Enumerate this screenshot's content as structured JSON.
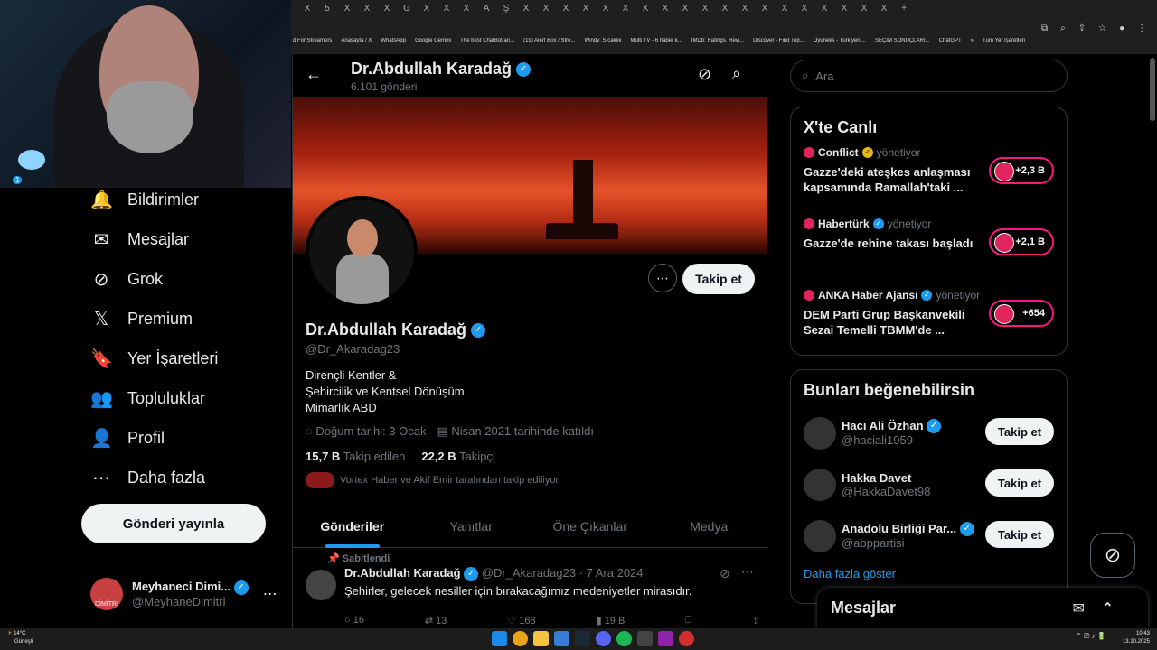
{
  "browser": {
    "tabs": [
      "X",
      "5",
      "X",
      "X",
      "X",
      "G",
      "X",
      "X",
      "X",
      "A",
      "Ş",
      "X",
      "X",
      "X",
      "X",
      "X",
      "X",
      "X",
      "X",
      "X",
      "X",
      "X",
      "X",
      "X",
      "X",
      "X",
      "X",
      "X",
      "X",
      "X",
      "+"
    ],
    "bookmarks": [
      "d For Streamers",
      "Anasayfa / X",
      "WhatsApp",
      "Google Gemini",
      "The best ChatBot an...",
      "(19) Alert Box / Stre...",
      "Windy: Sıcaklık",
      "Multi TV - 6 haber k...",
      "IMDb: Ratings, Revi...",
      "Discover - Find Top...",
      "Oyuneks - Türkiyeni...",
      "SEÇİM SONUÇLARI...",
      "ChatGPT",
      "»",
      "Tüm Yer İşaretleri"
    ]
  },
  "nav": {
    "items": [
      {
        "label": "Bildirimler",
        "icon": "bell-icon",
        "glyph": "🔔",
        "badge": "1"
      },
      {
        "label": "Mesajlar",
        "icon": "envelope-icon",
        "glyph": "✉"
      },
      {
        "label": "Grok",
        "icon": "grok-icon",
        "glyph": "⊘"
      },
      {
        "label": "Premium",
        "icon": "x-logo-icon",
        "glyph": "𝕏"
      },
      {
        "label": "Yer İşaretleri",
        "icon": "bookmark-icon",
        "glyph": "🔖"
      },
      {
        "label": "Topluluklar",
        "icon": "people-icon",
        "glyph": "👥"
      },
      {
        "label": "Profil",
        "icon": "person-icon",
        "glyph": "👤"
      },
      {
        "label": "Daha fazla",
        "icon": "more-circle-icon",
        "glyph": "⋯"
      }
    ],
    "post_button": "Gönderi yayınla",
    "account": {
      "name": "Meyhaneci Dimi...",
      "handle": "@MeyhaneDimitri",
      "avatar_text": "DİMİTRİ"
    }
  },
  "profile": {
    "header_name": "Dr.Abdullah Karadağ",
    "post_count": "6.101 gönderi",
    "name": "Dr.Abdullah Karadağ",
    "handle": "@Dr_Akaradag23",
    "bio": [
      "Dirençli Kentler &",
      "Şehircilik ve Kentsel Dönüşüm",
      "Mimarlık ABD"
    ],
    "birthday": "Doğum tarihi: 3 Ocak",
    "joined": "Nisan 2021 tarihinde katıldı",
    "following_count": "15,7 B",
    "following_label": "Takip edilen",
    "followers_count": "22,2 B",
    "followers_label": "Takipçi",
    "followed_by": "Vortex Haber ve Akif Emir tarafından takip ediliyor",
    "follow_button": "Takip et",
    "tabs": [
      "Gönderiler",
      "Yanıtlar",
      "Öne Çıkanlar",
      "Medya"
    ]
  },
  "pinned_post": {
    "pinned_label": "Sabitlendi",
    "name": "Dr.Abdullah Karadağ",
    "handle_date": "@Dr_Akaradag23 · 7 Ara 2024",
    "text": "Şehirler, gelecek nesiller için bırakacağımız medeniyetler mirasıdır.",
    "replies": "16",
    "reposts": "13",
    "likes": "168",
    "views": "19 B"
  },
  "sidebar": {
    "search_placeholder": "Ara",
    "live_title": "X'te Canlı",
    "live": [
      {
        "source": "Conflict",
        "status": "yönetiyor",
        "desc": "Gazze'deki ateşkes anlaşması kapsamında Ramallah'taki ...",
        "count": "+2,3 B",
        "verified": "gold"
      },
      {
        "source": "Habertürk",
        "status": "yönetiyor",
        "desc": "Gazze'de rehine takası başladı",
        "count": "+2,1 B",
        "verified": "blue"
      },
      {
        "source": "ANKA Haber Ajansı",
        "status": "yönetiyor",
        "desc": "DEM Parti Grup Başkanvekili Sezai Temelli TBMM'de ...",
        "count": "+654",
        "verified": "blue"
      }
    ],
    "suggest_title": "Bunları beğenebilirsin",
    "suggestions": [
      {
        "name": "Hacı Ali Özhan",
        "handle": "@haciali1959",
        "verified": true,
        "button": "Takip et"
      },
      {
        "name": "Hakka Davet",
        "handle": "@HakkaDavet98",
        "verified": false,
        "button": "Takip et"
      },
      {
        "name": "Anadolu Birliği Par...",
        "handle": "@abppartisi",
        "verified": true,
        "button": "Takip et"
      }
    ],
    "show_more": "Daha fazla göster"
  },
  "messages_drawer": {
    "title": "Mesajlar"
  },
  "taskbar": {
    "weather": "14°C",
    "weather_desc": "Güneşli",
    "time": "10:43",
    "date": "13.10.2025"
  },
  "colors": {
    "accent": "#1d9bf0",
    "live_border": "#f91880",
    "background": "#000000"
  }
}
